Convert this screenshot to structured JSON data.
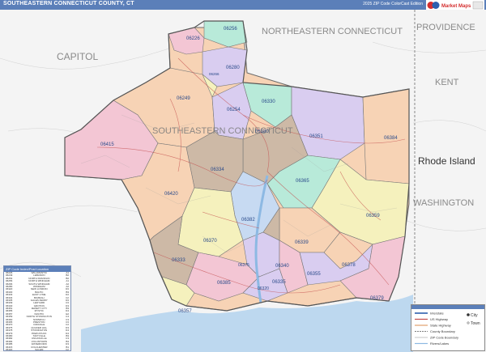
{
  "header": {
    "title": "SOUTHEASTERN CONNECTICUT COUNTY, CT",
    "edition": "2025 ZIP Code ColorCast Edition"
  },
  "brand": {
    "logo_text": "Market Maps"
  },
  "map": {
    "center_label": "SOUTHEASTERN CONNECTICUT",
    "region_labels": {
      "capitol": "CAPITOL",
      "northeastern": "NORTHEASTERN CONNECTICUT",
      "providence": "PROVIDENCE",
      "kent": "KENT",
      "rhode_island": "Rhode Island",
      "washington": "WASHINGTON"
    },
    "zip_labels": {
      "z06226": "06226",
      "z06256": "06256",
      "z06280": "06280",
      "z06266": "06266",
      "z06249": "06249",
      "z06254": "06254",
      "z06330": "06330",
      "z06380": "06380",
      "z06351": "06351",
      "z06384": "06384",
      "z06415": "06415",
      "z06334": "06334",
      "z06365": "06365",
      "z06420": "06420",
      "z06382": "06382",
      "z06359": "06359",
      "z06370": "06370",
      "z06339": "06339",
      "z06333": "06333",
      "z06375": "06375",
      "z06340": "06340",
      "z06378": "06378",
      "z06335": "06335",
      "z06355": "06355",
      "z06385": "06385",
      "z06379": "06379",
      "z06357": "06357",
      "z06320": "06320"
    },
    "colors": {
      "pink": "#f3c6d4",
      "peach": "#f7d3b5",
      "lavender": "#d9cdf0",
      "mint": "#b8ead9",
      "yellow": "#f5f1bd",
      "tan": "#cdb9a6",
      "sky": "#c7daf2",
      "water": "#bdd8ef",
      "outside": "#f4f4f4",
      "road": "#c24a4a",
      "boundary": "#6a6a6a"
    }
  },
  "legend": {
    "title": "ZIP Code Index/Post Location",
    "rows": [
      [
        "06226",
        "WILLIMANTIC",
        "A1"
      ],
      [
        "06249",
        "LEBANON",
        "B2"
      ],
      [
        "06254",
        "NORTH FRANKLIN",
        "B2"
      ],
      [
        "06256",
        "NORTH WINDHAM",
        "A1"
      ],
      [
        "06266",
        "SOUTH WINDHAM",
        "A2"
      ],
      [
        "06280",
        "WINDHAM",
        "A2"
      ],
      [
        "06320",
        "NEW LONDON",
        "D3"
      ],
      [
        "06330",
        "BALTIC",
        "B3"
      ],
      [
        "06333",
        "EAST LYME",
        "D2"
      ],
      [
        "06334",
        "BOZRAH",
        "C2"
      ],
      [
        "06335",
        "GALES FERRY",
        "D3"
      ],
      [
        "06339",
        "LEDYARD",
        "C3"
      ],
      [
        "06340",
        "GROTON",
        "D3"
      ],
      [
        "06351",
        "JEWETT CITY",
        "B3"
      ],
      [
        "06355",
        "MYSTIC",
        "D4"
      ],
      [
        "06357",
        "NIANTIC",
        "E2"
      ],
      [
        "06359",
        "NORTH STONINGTON",
        "C4"
      ],
      [
        "06360",
        "NORWICH",
        "C3"
      ],
      [
        "06365",
        "PRESTON",
        "C3"
      ],
      [
        "06370",
        "OAKDALE",
        "C2"
      ],
      [
        "06375",
        "QUAKER HILL",
        "D3"
      ],
      [
        "06378",
        "STONINGTON",
        "D4"
      ],
      [
        "06379",
        "PAWCATUCK",
        "D4"
      ],
      [
        "06380",
        "TAFTVILLE",
        "B3"
      ],
      [
        "06382",
        "UNCASVILLE",
        "C3"
      ],
      [
        "06384",
        "VOLUNTOWN",
        "B4"
      ],
      [
        "06385",
        "WATERFORD",
        "D3"
      ],
      [
        "06415",
        "COLCHESTER",
        "B1"
      ],
      [
        "06420",
        "SALEM",
        "C2"
      ]
    ]
  },
  "key": {
    "rows": [
      "Interstate",
      "US Highway",
      "State Highway",
      "County Boundary",
      "ZIP Code Boundary",
      "Rivers/Lakes"
    ],
    "city_marker": "City",
    "town_marker": "Town"
  }
}
